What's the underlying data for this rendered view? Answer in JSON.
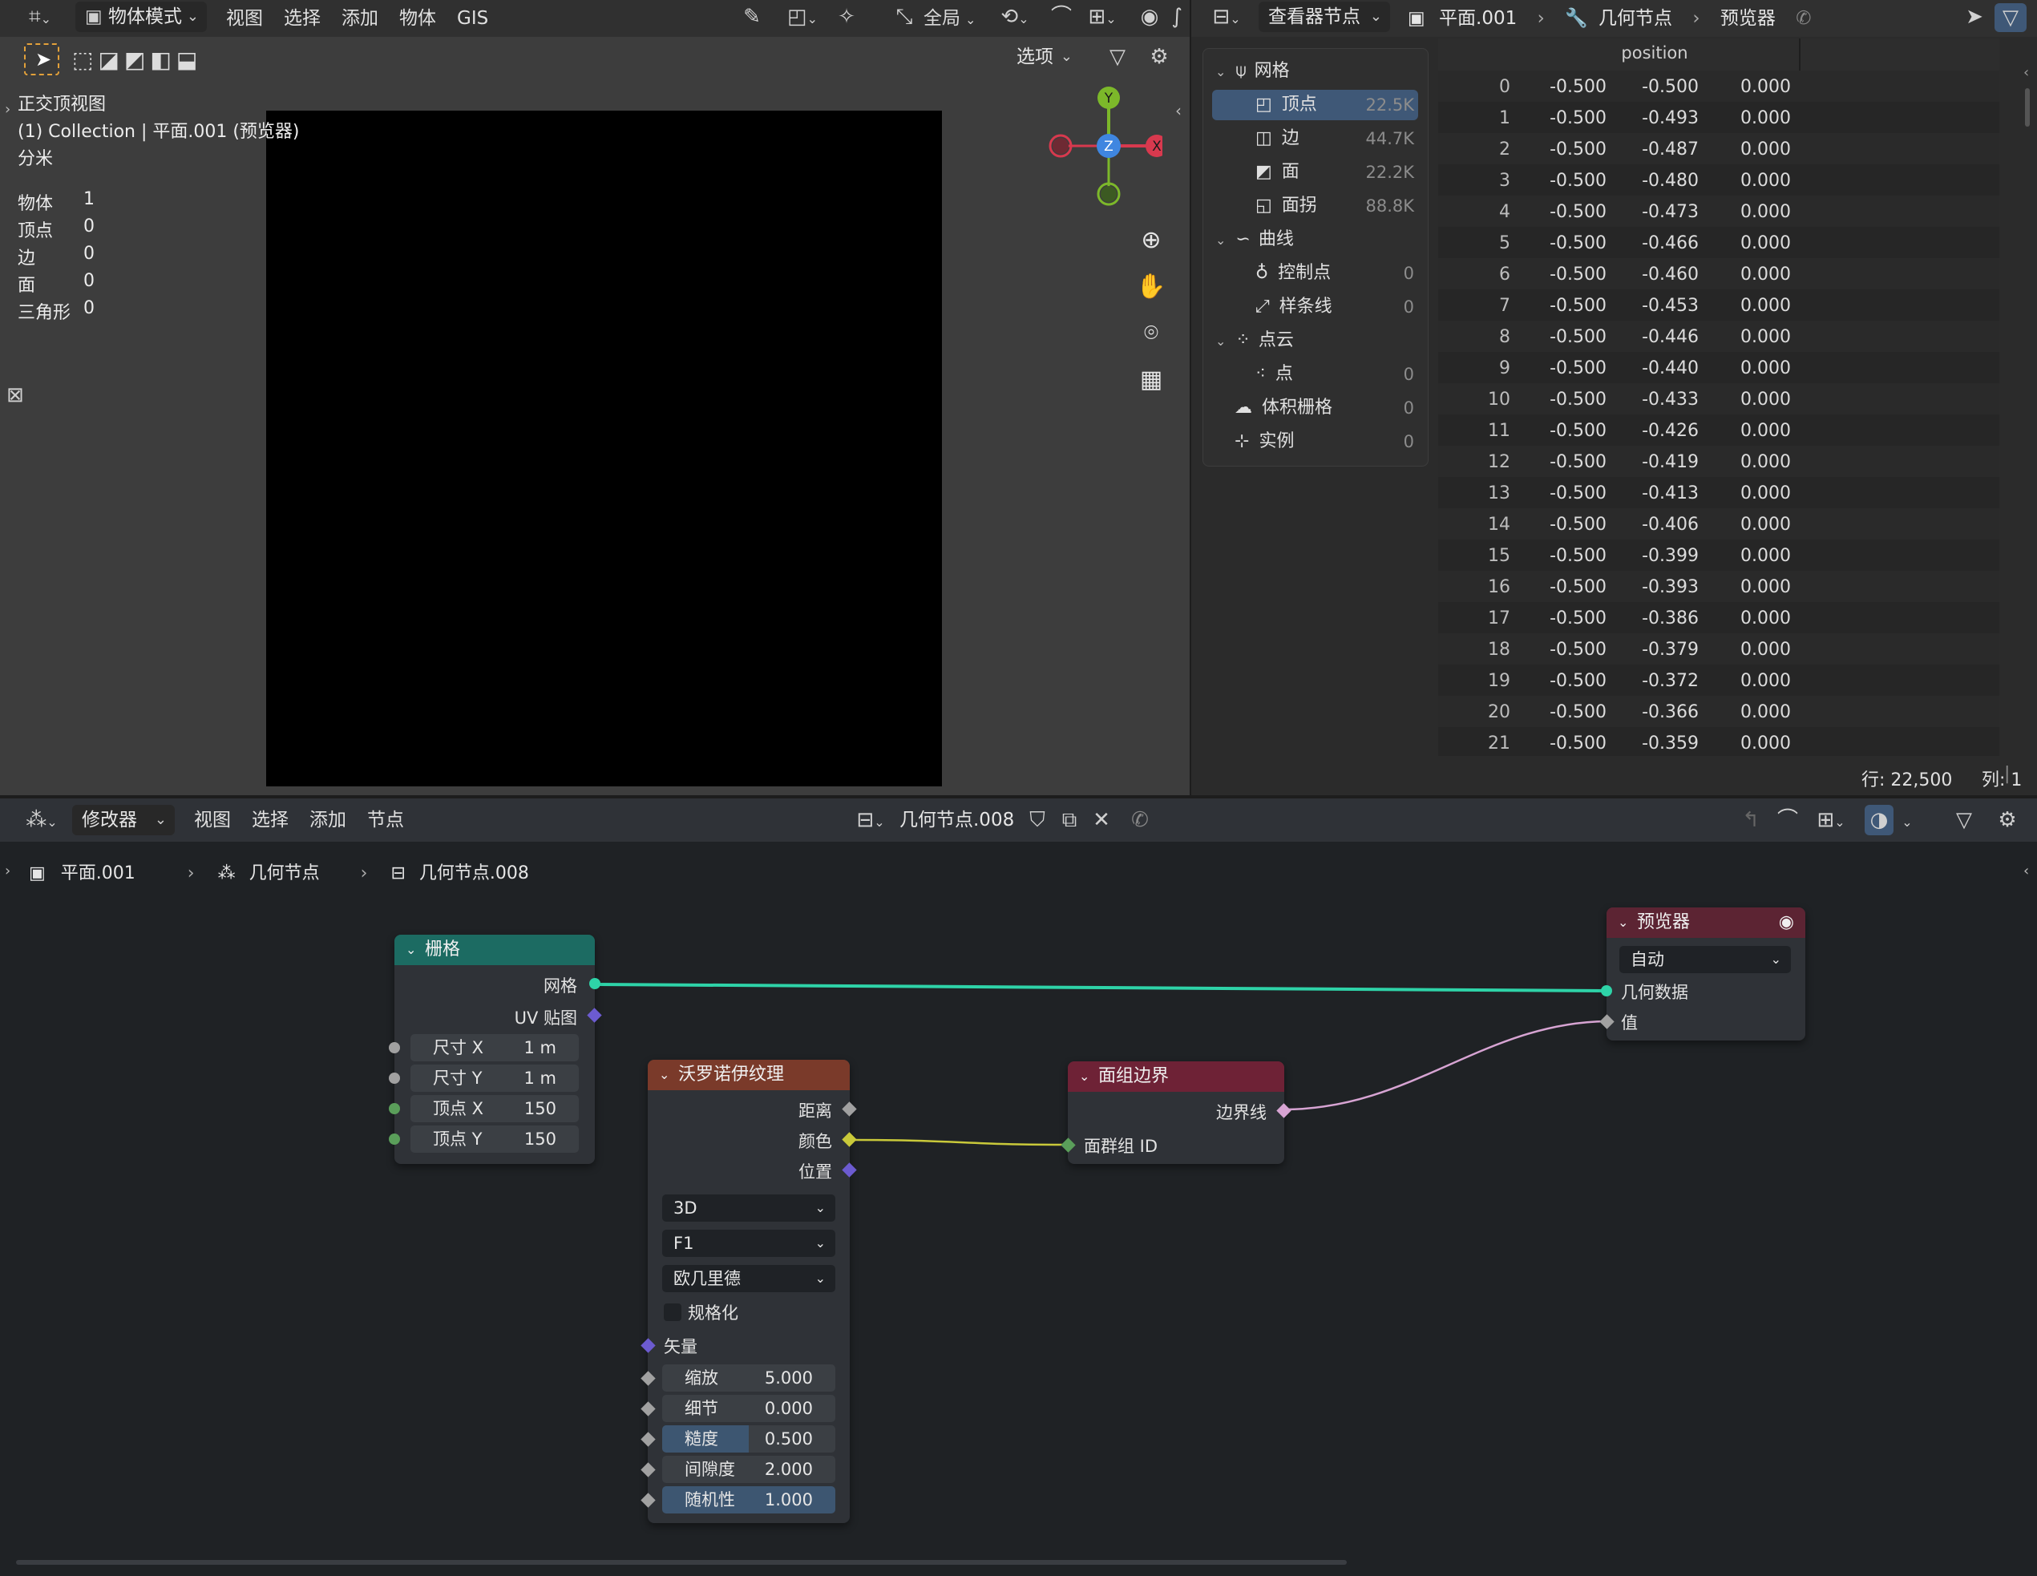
{
  "viewport": {
    "header": {
      "mode_label": "物体模式",
      "menus": [
        "视图",
        "选择",
        "添加",
        "物体",
        "GIS"
      ],
      "transform_orientation": "全局",
      "options_label": "选项"
    },
    "overlay": {
      "view_name": "正交顶视图",
      "collection_line": "(1) Collection | 平面.001 (预览器)",
      "unit": "分米",
      "stats": [
        {
          "label": "物体",
          "value": "1"
        },
        {
          "label": "顶点",
          "value": "0"
        },
        {
          "label": "边",
          "value": "0"
        },
        {
          "label": "面",
          "value": "0"
        },
        {
          "label": "三角形",
          "value": "0"
        }
      ]
    },
    "gizmo": {
      "y": "Y",
      "x": "X",
      "z": "Z"
    }
  },
  "spreadsheet": {
    "header": {
      "display_mode": "查看器节点",
      "breadcrumb": [
        "平面.001",
        "几何节点",
        "预览器"
      ]
    },
    "tree": [
      {
        "label": "网格",
        "count": "",
        "level": 0,
        "icon": "mesh-icon"
      },
      {
        "label": "顶点",
        "count": "22.5K",
        "level": 1,
        "icon": "vertex-icon",
        "selected": true
      },
      {
        "label": "边",
        "count": "44.7K",
        "level": 1,
        "icon": "edge-icon"
      },
      {
        "label": "面",
        "count": "22.2K",
        "level": 1,
        "icon": "face-icon"
      },
      {
        "label": "面拐",
        "count": "88.8K",
        "level": 1,
        "icon": "face-corner-icon"
      },
      {
        "label": "曲线",
        "count": "",
        "level": 0,
        "icon": "curve-icon"
      },
      {
        "label": "控制点",
        "count": "0",
        "level": 1,
        "icon": "control-point-icon"
      },
      {
        "label": "样条线",
        "count": "0",
        "level": 1,
        "icon": "spline-icon"
      },
      {
        "label": "点云",
        "count": "",
        "level": 0,
        "icon": "point-cloud-icon"
      },
      {
        "label": "点",
        "count": "0",
        "level": 1,
        "icon": "point-icon"
      },
      {
        "label": "体积栅格",
        "count": "0",
        "level": 0,
        "icon": "volume-icon"
      },
      {
        "label": "实例",
        "count": "0",
        "level": 0,
        "icon": "instance-icon"
      }
    ],
    "column_header": "position",
    "rows": [
      [
        "0",
        "-0.500",
        "-0.500",
        "0.000"
      ],
      [
        "1",
        "-0.500",
        "-0.493",
        "0.000"
      ],
      [
        "2",
        "-0.500",
        "-0.487",
        "0.000"
      ],
      [
        "3",
        "-0.500",
        "-0.480",
        "0.000"
      ],
      [
        "4",
        "-0.500",
        "-0.473",
        "0.000"
      ],
      [
        "5",
        "-0.500",
        "-0.466",
        "0.000"
      ],
      [
        "6",
        "-0.500",
        "-0.460",
        "0.000"
      ],
      [
        "7",
        "-0.500",
        "-0.453",
        "0.000"
      ],
      [
        "8",
        "-0.500",
        "-0.446",
        "0.000"
      ],
      [
        "9",
        "-0.500",
        "-0.440",
        "0.000"
      ],
      [
        "10",
        "-0.500",
        "-0.433",
        "0.000"
      ],
      [
        "11",
        "-0.500",
        "-0.426",
        "0.000"
      ],
      [
        "12",
        "-0.500",
        "-0.419",
        "0.000"
      ],
      [
        "13",
        "-0.500",
        "-0.413",
        "0.000"
      ],
      [
        "14",
        "-0.500",
        "-0.406",
        "0.000"
      ],
      [
        "15",
        "-0.500",
        "-0.399",
        "0.000"
      ],
      [
        "16",
        "-0.500",
        "-0.393",
        "0.000"
      ],
      [
        "17",
        "-0.500",
        "-0.386",
        "0.000"
      ],
      [
        "18",
        "-0.500",
        "-0.379",
        "0.000"
      ],
      [
        "19",
        "-0.500",
        "-0.372",
        "0.000"
      ],
      [
        "20",
        "-0.500",
        "-0.366",
        "0.000"
      ],
      [
        "21",
        "-0.500",
        "-0.359",
        "0.000"
      ]
    ],
    "status": {
      "rows": "行: 22,500",
      "cols": "列: 1"
    }
  },
  "node_editor": {
    "header": {
      "editor_type": "修改器",
      "menus": [
        "视图",
        "选择",
        "添加",
        "节点"
      ],
      "node_group": "几何节点.008"
    },
    "breadcrumb": [
      "平面.001",
      "几何节点",
      "几何节点.008"
    ],
    "nodes": {
      "grid": {
        "title": "栅格",
        "out_mesh": "网格",
        "out_uv": "UV 贴图",
        "size_x_label": "尺寸 X",
        "size_x": "1 m",
        "size_y_label": "尺寸 Y",
        "size_y": "1 m",
        "verts_x_label": "顶点 X",
        "verts_x": "150",
        "verts_y_label": "顶点 Y",
        "verts_y": "150"
      },
      "voronoi": {
        "title": "沃罗诺伊纹理",
        "out_distance": "距离",
        "out_color": "颜色",
        "out_position": "位置",
        "dimensions": "3D",
        "feature": "F1",
        "metric": "欧几里德",
        "normalize": "规格化",
        "vector": "矢量",
        "scale_label": "缩放",
        "scale": "5.000",
        "detail_label": "细节",
        "detail": "0.000",
        "roughness_label": "糙度",
        "roughness": "0.500",
        "lacunarity_label": "间隙度",
        "lacunarity": "2.000",
        "randomness_label": "随机性",
        "randomness": "1.000"
      },
      "face_boundaries": {
        "title": "面组边界",
        "out_edges": "边界线",
        "in_face_group": "面群组 ID"
      },
      "viewer": {
        "title": "预览器",
        "domain": "自动",
        "in_geometry": "几何数据",
        "in_value": "值"
      }
    }
  },
  "colors": {
    "geometry_link": "#2ed3a8",
    "color_link": "#c9c93a",
    "boolean_link": "#d7a4d3",
    "grid_header": "#1c6b62",
    "voronoi_header": "#7a3a2a",
    "face_boundaries_header": "#6e2236",
    "viewer_header": "#5c2433",
    "selection": "#3f5877"
  }
}
